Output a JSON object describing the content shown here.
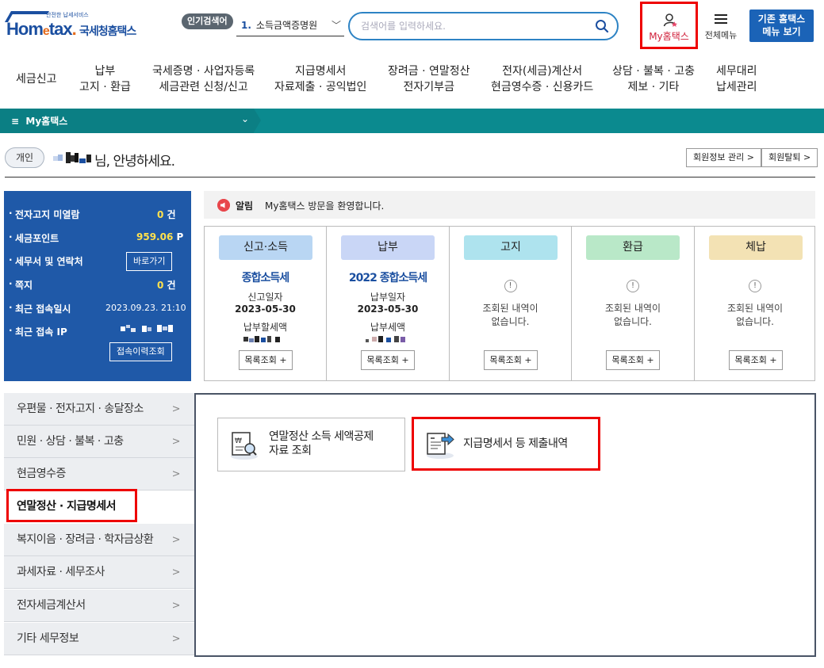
{
  "header": {
    "logo_small": "안전한 납세서비스",
    "logo_main_a": "Hom",
    "logo_main_e": "e",
    "logo_main_b": "tax",
    "logo_dot": ".",
    "logo_kr": "국세청홈택스",
    "popular_label": "인기검색어",
    "popular_num": "1.",
    "popular_term": "소득금액증명원",
    "search_placeholder": "검색어를 입력하세요.",
    "my_hometax": "My홈택스",
    "all_menu": "전체메뉴",
    "old_hometax_line1": "기존 홈택스",
    "old_hometax_line2": "메뉴 보기"
  },
  "gnb": [
    {
      "line1": "세금신고",
      "line2": ""
    },
    {
      "line1": "납부",
      "line2": "고지 · 환급"
    },
    {
      "line1": "국세증명 · 사업자등록",
      "line2": "세금관련 신청/신고"
    },
    {
      "line1": "지급명세서",
      "line2": "자료제출 · 공익법인"
    },
    {
      "line1": "장려금 · 연말정산",
      "line2": "전자기부금"
    },
    {
      "line1": "전자(세금)계산서",
      "line2": "현금영수증 · 신용카드"
    },
    {
      "line1": "상담 · 불복 · 고충",
      "line2": "제보 · 기타"
    },
    {
      "line1": "세무대리",
      "line2": "납세관리"
    }
  ],
  "breadcrumb": {
    "menu_icon": "≡",
    "label": "My홈택스"
  },
  "greeting": {
    "badge": "개인",
    "suffix": "님, 안녕하세요.",
    "member_info_btn": "회원정보 관리 >",
    "withdraw_btn": "회원탈퇴 >"
  },
  "summary": {
    "unread_label": "전자고지 미열람",
    "unread_count": "0",
    "unread_unit": "건",
    "points_label": "세금포인트",
    "points_value": "959.06",
    "points_unit": "P",
    "office_label": "세무서 및 연락처",
    "office_btn": "바로가기",
    "note_label": "쪽지",
    "note_count": "0",
    "note_unit": "건",
    "last_login_label": "최근 접속일시",
    "last_login_value": "2023.09.23.  21:10",
    "last_ip_label": "최근 접속 IP",
    "history_btn": "접속이력조회"
  },
  "alert": {
    "label": "알림",
    "text": "My홈택스 방문을 환영합니다."
  },
  "cards": [
    {
      "tag": "신고·소득",
      "color": "#b9d6f3",
      "title": "종합소득세",
      "sub1": "신고일자",
      "date": "2023-05-30",
      "sub2": "납부할세액",
      "btn": "목록조회 +"
    },
    {
      "tag": "납부",
      "color": "#c9d6f6",
      "title": "2022 종합소득세",
      "sub1": "납부일자",
      "date": "2023-05-30",
      "sub2": "납부세액",
      "btn": "목록조회 +"
    },
    {
      "tag": "고지",
      "color": "#aee3ee",
      "empty_icon": "!",
      "empty1": "조회된 내역이",
      "empty2": "없습니다.",
      "btn": "목록조회 +"
    },
    {
      "tag": "환급",
      "color": "#b9e8c8",
      "empty_icon": "!",
      "empty1": "조회된 내역이",
      "empty2": "없습니다.",
      "btn": "목록조회 +"
    },
    {
      "tag": "체납",
      "color": "#f3e2b4",
      "empty_icon": "!",
      "empty1": "조회된 내역이",
      "empty2": "없습니다.",
      "btn": "목록조회 +"
    }
  ],
  "side_menu": [
    {
      "label": "우편물 · 전자고지 · 송달장소",
      "active": false
    },
    {
      "label": "민원 · 상담 · 불복 · 고충",
      "active": false
    },
    {
      "label": "현금영수증",
      "active": false
    },
    {
      "label": "연말정산 · 지급명세서",
      "active": true
    },
    {
      "label": "복지이음 · 장려금 · 학자금상환",
      "active": false
    },
    {
      "label": "과세자료 · 세무조사",
      "active": false
    },
    {
      "label": "전자세금계산서",
      "active": false
    },
    {
      "label": "기타 세무정보",
      "active": false
    }
  ],
  "side_arrow": ">",
  "sub_items": {
    "year_end_line1": "연말정산 소득 세액공제",
    "year_end_line2": "자료 조회",
    "payment_statement": "지급명세서 등 제출내역"
  },
  "colors": {
    "brand_blue": "#1b4fa0",
    "teal": "#0b8a8f",
    "panel_blue": "#1f59a8",
    "highlight_red": "#e00000"
  }
}
